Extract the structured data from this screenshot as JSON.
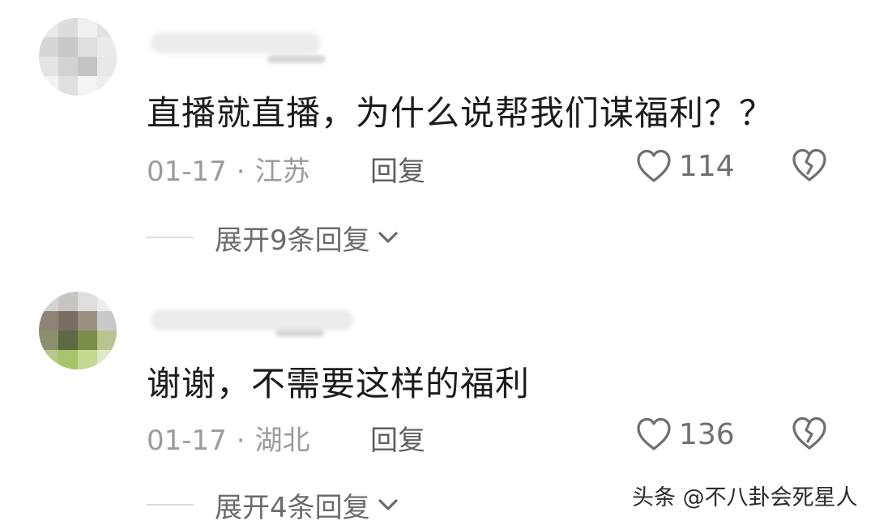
{
  "comments": [
    {
      "text": "直播就直播，为什么说帮我们谋福利？？",
      "date": "01-17",
      "location": "江苏",
      "reply_label": "回复",
      "likes": "114",
      "expand_label": "展开9条回复"
    },
    {
      "text": "谢谢，不需要这样的福利",
      "date": "01-17",
      "location": "湖北",
      "reply_label": "回复",
      "likes": "136",
      "expand_label": "展开4条回复"
    }
  ],
  "meta_separator": "·",
  "icons": {
    "like": "heart-outline-icon",
    "dislike": "broken-heart-icon",
    "expand": "chevron-down-icon"
  },
  "watermark": "头条 @不八卦会死星人",
  "colors": {
    "text_primary": "#1c1c1c",
    "text_secondary": "#9b9b9b",
    "icon": "#6f6f6f"
  }
}
